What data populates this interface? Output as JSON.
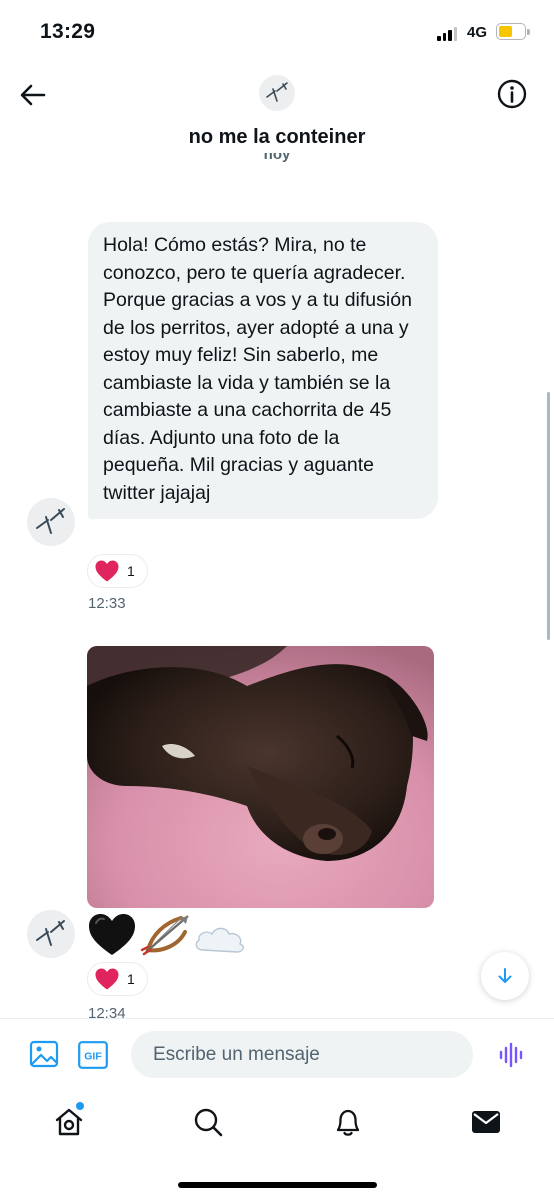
{
  "status_bar": {
    "time": "13:29",
    "network": "4G",
    "battery_level": 0.55
  },
  "header": {
    "back_icon": "arrow-left-icon",
    "info_icon": "info-circle-icon",
    "title": "no me la conteiner",
    "date_separator": "hoy"
  },
  "messages": [
    {
      "text": "Hola! Cómo estás? Mira, no te conozco, pero te quería agradecer. Porque gracias a vos y a tu difusión de los perritos, ayer adopté a una y estoy muy feliz! Sin saberlo, me cambiaste la vida y también se la cambiaste a una cachorrita de 45 días. Adjunto una foto de la pequeña. Mil gracias y aguante twitter jajajaj",
      "reaction_count": "1",
      "time": "12:33"
    },
    {
      "image_alt": "dachshund puppy sleeping on a pink blanket",
      "emojis": "🖤🏹☁️",
      "reaction_count": "1",
      "time": "12:34"
    }
  ],
  "composer": {
    "placeholder": "Escribe un mensaje",
    "gif_label": "GIF",
    "image_icon": "image-icon",
    "voice_icon": "voice-waveform-icon"
  },
  "bottom_nav": {
    "items": [
      "home-icon",
      "search-icon",
      "notifications-bell-icon",
      "messages-envelope-icon"
    ]
  },
  "colors": {
    "accent": "#1d9bf0",
    "bubble": "#eff3f4",
    "heart": "#f91880",
    "voice_accent": "#7856ff",
    "battery": "#f7c600"
  }
}
